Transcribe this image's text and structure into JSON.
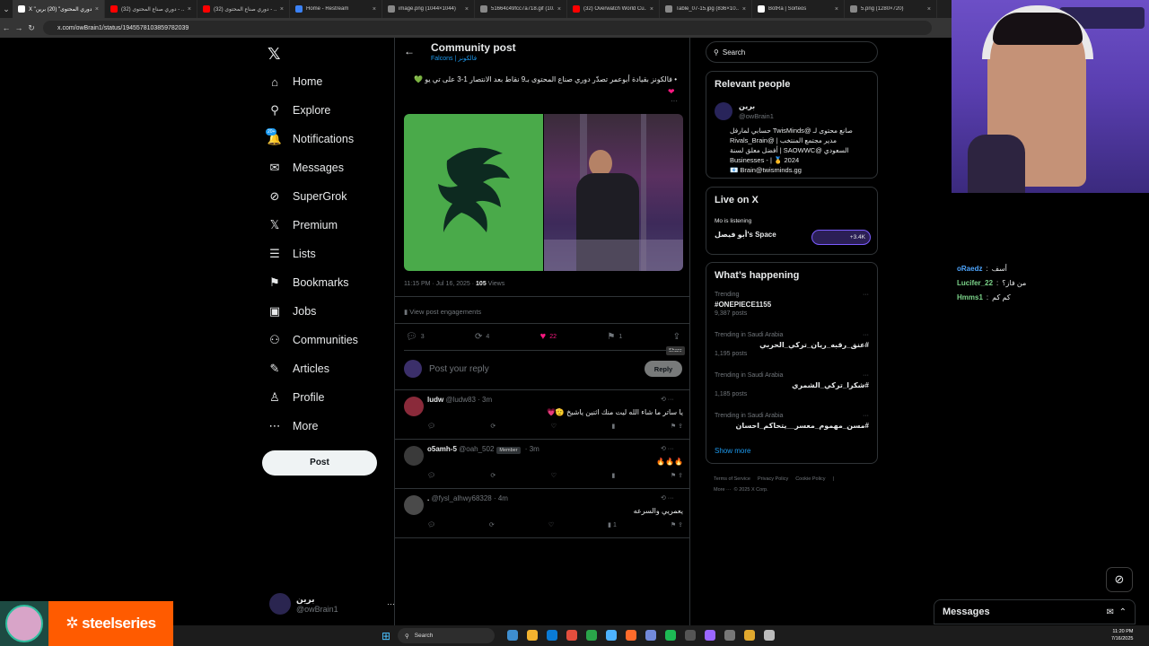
{
  "browser": {
    "tabs": [
      {
        "label": "X \"دوري المحتوى\" (20) برين",
        "color": "#ffffff",
        "active": true
      },
      {
        "label": "(32) دوري صناع المحتوى - ...",
        "color": "#ff0000"
      },
      {
        "label": "(32) دوري صناع المحتوى - ...",
        "color": "#ff0000"
      },
      {
        "label": "Home - Restream",
        "color": "#3b82f6"
      },
      {
        "label": "image.png (1044×1044)",
        "color": "#888888"
      },
      {
        "label": "51664c49fcc7a718.gif (10...",
        "color": "#888888"
      },
      {
        "label": "(32) Overwatch World Cu...",
        "color": "#ff0000"
      },
      {
        "label": "Table_07-15.jpg (836×10...",
        "color": "#888888"
      },
      {
        "label": "BotRa | Sorteos",
        "color": "#ffffff"
      },
      {
        "label": "5.png (1280×720)",
        "color": "#888888"
      }
    ],
    "url": "x.com/owBrain1/status/1945578103859782039"
  },
  "nav": {
    "items": [
      {
        "label": "Home",
        "icon": "home-icon",
        "glyph": "⌂"
      },
      {
        "label": "Explore",
        "icon": "search-icon",
        "glyph": "⚲"
      },
      {
        "label": "Notifications",
        "icon": "bell-icon",
        "glyph": "🔔"
      },
      {
        "label": "Messages",
        "icon": "mail-icon",
        "glyph": "✉"
      },
      {
        "label": "SuperGrok",
        "icon": "grok-icon",
        "glyph": "⊘"
      },
      {
        "label": "Premium",
        "icon": "x-icon",
        "glyph": "𝕏"
      },
      {
        "label": "Lists",
        "icon": "lists-icon",
        "glyph": "☰"
      },
      {
        "label": "Bookmarks",
        "icon": "bookmark-icon",
        "glyph": "⚑"
      },
      {
        "label": "Jobs",
        "icon": "briefcase-icon",
        "glyph": "▣"
      },
      {
        "label": "Communities",
        "icon": "communities-icon",
        "glyph": "⚇"
      },
      {
        "label": "Articles",
        "icon": "article-icon",
        "glyph": "✎"
      },
      {
        "label": "Profile",
        "icon": "profile-icon",
        "glyph": "♙"
      },
      {
        "label": "More",
        "icon": "more-circle-icon",
        "glyph": "⋯"
      }
    ],
    "notif_badge": "20+",
    "post_button": "Post",
    "account": {
      "name": "برين",
      "handle": "@owBrain1"
    }
  },
  "post": {
    "header_title": "Community post",
    "header_sub": "Falcons | فالكونز",
    "text": "• فالكونز بقيادة أبوعمر تصدّر دوري صناع المحتوى بـ9 نقاط بعد الانتصار 1-3 على تي يو 💚",
    "time": "11:15 PM · Jul 16, 2025 · ",
    "views_num": "105",
    "views_label": " Views",
    "engagements": "View post engagements",
    "counts": {
      "replies": "3",
      "reposts": "4",
      "likes": "22",
      "bookmarks": "1"
    },
    "share_tooltip": "Share",
    "reply_placeholder": "Post your reply",
    "reply_button": "Reply"
  },
  "replies": [
    {
      "name": "ludw",
      "handle": "@ludw83",
      "time": " · 3m",
      "text": "يا ساتر ما شاء الله ليت منك اثنين ياشيخ 🫡💗",
      "views": "",
      "member": ""
    },
    {
      "name": "o5amh-5",
      "handle": "@oah_502",
      "time": " · 3m",
      "text": "🔥🔥🔥",
      "views": "",
      "member": "Member"
    },
    {
      "name": ".",
      "handle": "@fysl_alhwy68328",
      "time": " · 4m",
      "text": "يعمريي  والسرعه",
      "views": "1",
      "member": ""
    }
  ],
  "right": {
    "search_placeholder": "Search",
    "relevant_title": "Relevant people",
    "person": {
      "name": "برين",
      "handle": "@owBrain1",
      "bio1": "صانع محتوى لـ @TwisMinds حسابي لمارفل",
      "bio2": "مدير مجتمع المنتخب | @Rivals_Brain",
      "bio3": "السعودي @SAOWWC | أفضل معلق لسنة",
      "bio4": "Businesses - | 🥇 2024",
      "bio5": "📧 Brain@twisminds.gg"
    },
    "live_title": "Live on X",
    "live_listening": "Mo is listening",
    "live_space": "أبو فيصل's Space",
    "live_count": "+3.4K",
    "happening_title": "What’s happening",
    "trends": [
      {
        "context": "Trending",
        "topic": "#ONEPIECE1155",
        "posts": "9,387 posts",
        "rtl": false
      },
      {
        "context": "Trending in Saudi Arabia",
        "topic": "#عنق_رقبه_ريان_تركي_الحربي",
        "posts": "1,195 posts",
        "rtl": true
      },
      {
        "context": "Trending in Saudi Arabia",
        "topic": "#شكرا_تركي_الشمري",
        "posts": "1,185 posts",
        "rtl": true
      },
      {
        "context": "Trending in Saudi Arabia",
        "topic": "#مسن_مهموم_معسر__يتحاكم_احسان",
        "posts": "",
        "rtl": true
      }
    ],
    "show_more": "Show more",
    "footer_links": [
      "Terms of Service",
      "Privacy Policy",
      "Cookie Policy",
      "|"
    ],
    "footer_more": "More ···",
    "copyright": "© 2025 X Corp."
  },
  "stream": {
    "chat": [
      {
        "user": "oRaedz",
        "msg": "أسف",
        "user_color": "#4ea6ff"
      },
      {
        "user": "Lucifer_22",
        "msg": "من فاز؟",
        "user_color": "#7bd389"
      },
      {
        "user": "Hmms1",
        "msg": "كم كم",
        "user_color": "#7bd389"
      }
    ],
    "messages_title": "Messages",
    "sponsor": "steelseries"
  },
  "taskbar": {
    "search_label": "Search",
    "time": "11:20 PM",
    "date": "7/16/2025"
  }
}
